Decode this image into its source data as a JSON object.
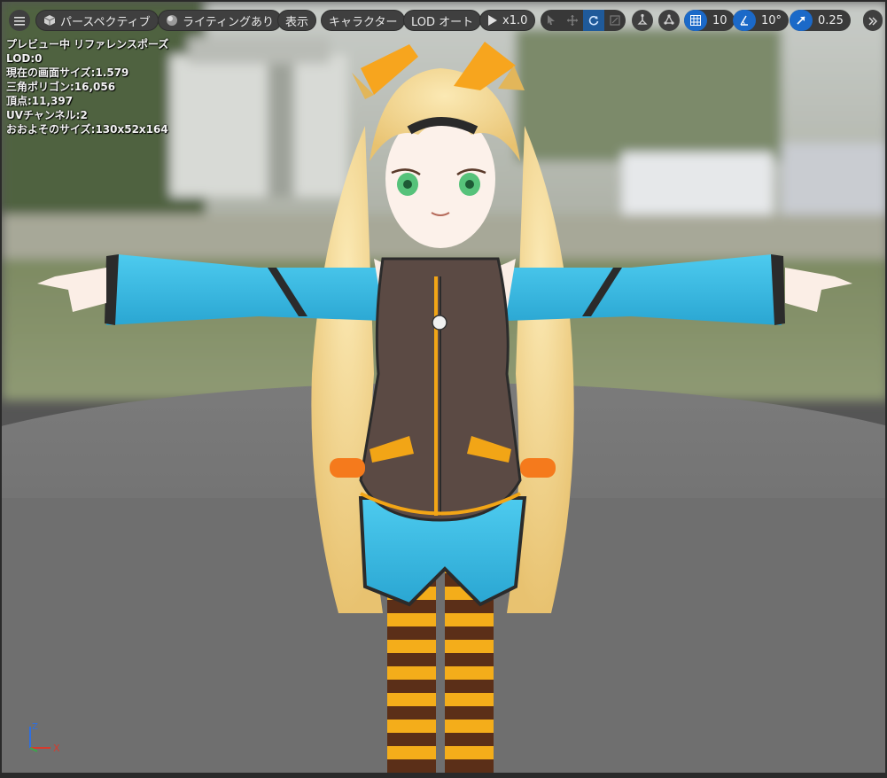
{
  "toolbar": {
    "menu_icon": "hamburger-menu-icon",
    "perspective": {
      "label": "パースペクティブ",
      "icon": "cube-icon"
    },
    "lighting": {
      "label": "ライティングあり",
      "icon": "lit-sphere-icon"
    },
    "show": {
      "label": "表示"
    },
    "character": {
      "label": "キャラクター"
    },
    "lod": {
      "label": "LOD オート"
    },
    "playback": {
      "label": "x1.0",
      "icon": "play-icon"
    },
    "transform_tools": [
      "select-arrow-icon",
      "translate-icon",
      "rotate-icon",
      "scale-icon"
    ],
    "transform_active": "rotate-icon",
    "surface_snap_icon": "surface-snap-icon",
    "world_local_icon": "world-space-icon",
    "grid_snap": {
      "value": "10",
      "icon": "grid-icon"
    },
    "rotation_snap": {
      "value": "10°",
      "icon": "angle-icon"
    },
    "scale_snap": {
      "value": "0.25",
      "icon": "scale-arrow-icon"
    },
    "overflow_icon": "chevron-double-right-icon"
  },
  "info": {
    "line1": "プレビュー中 リファレンスポーズ",
    "line2": "LOD:0",
    "line3": "現在の画面サイズ:1.579",
    "line4": "三角ポリゴン:16,056",
    "line5": "頂点:11,397",
    "line6": "UVチャンネル:2",
    "line7": "おおよそのサイズ:130x52x164"
  },
  "axis_gizmo": {
    "z": "Z",
    "x": "X"
  },
  "colors": {
    "accent": "#1b69c8",
    "hair": "#f3d58a",
    "jacket": "#3dbbe2",
    "vest": "#5b4a44",
    "stripe_orange": "#f2a516",
    "stripe_brown": "#5a2f1a"
  }
}
